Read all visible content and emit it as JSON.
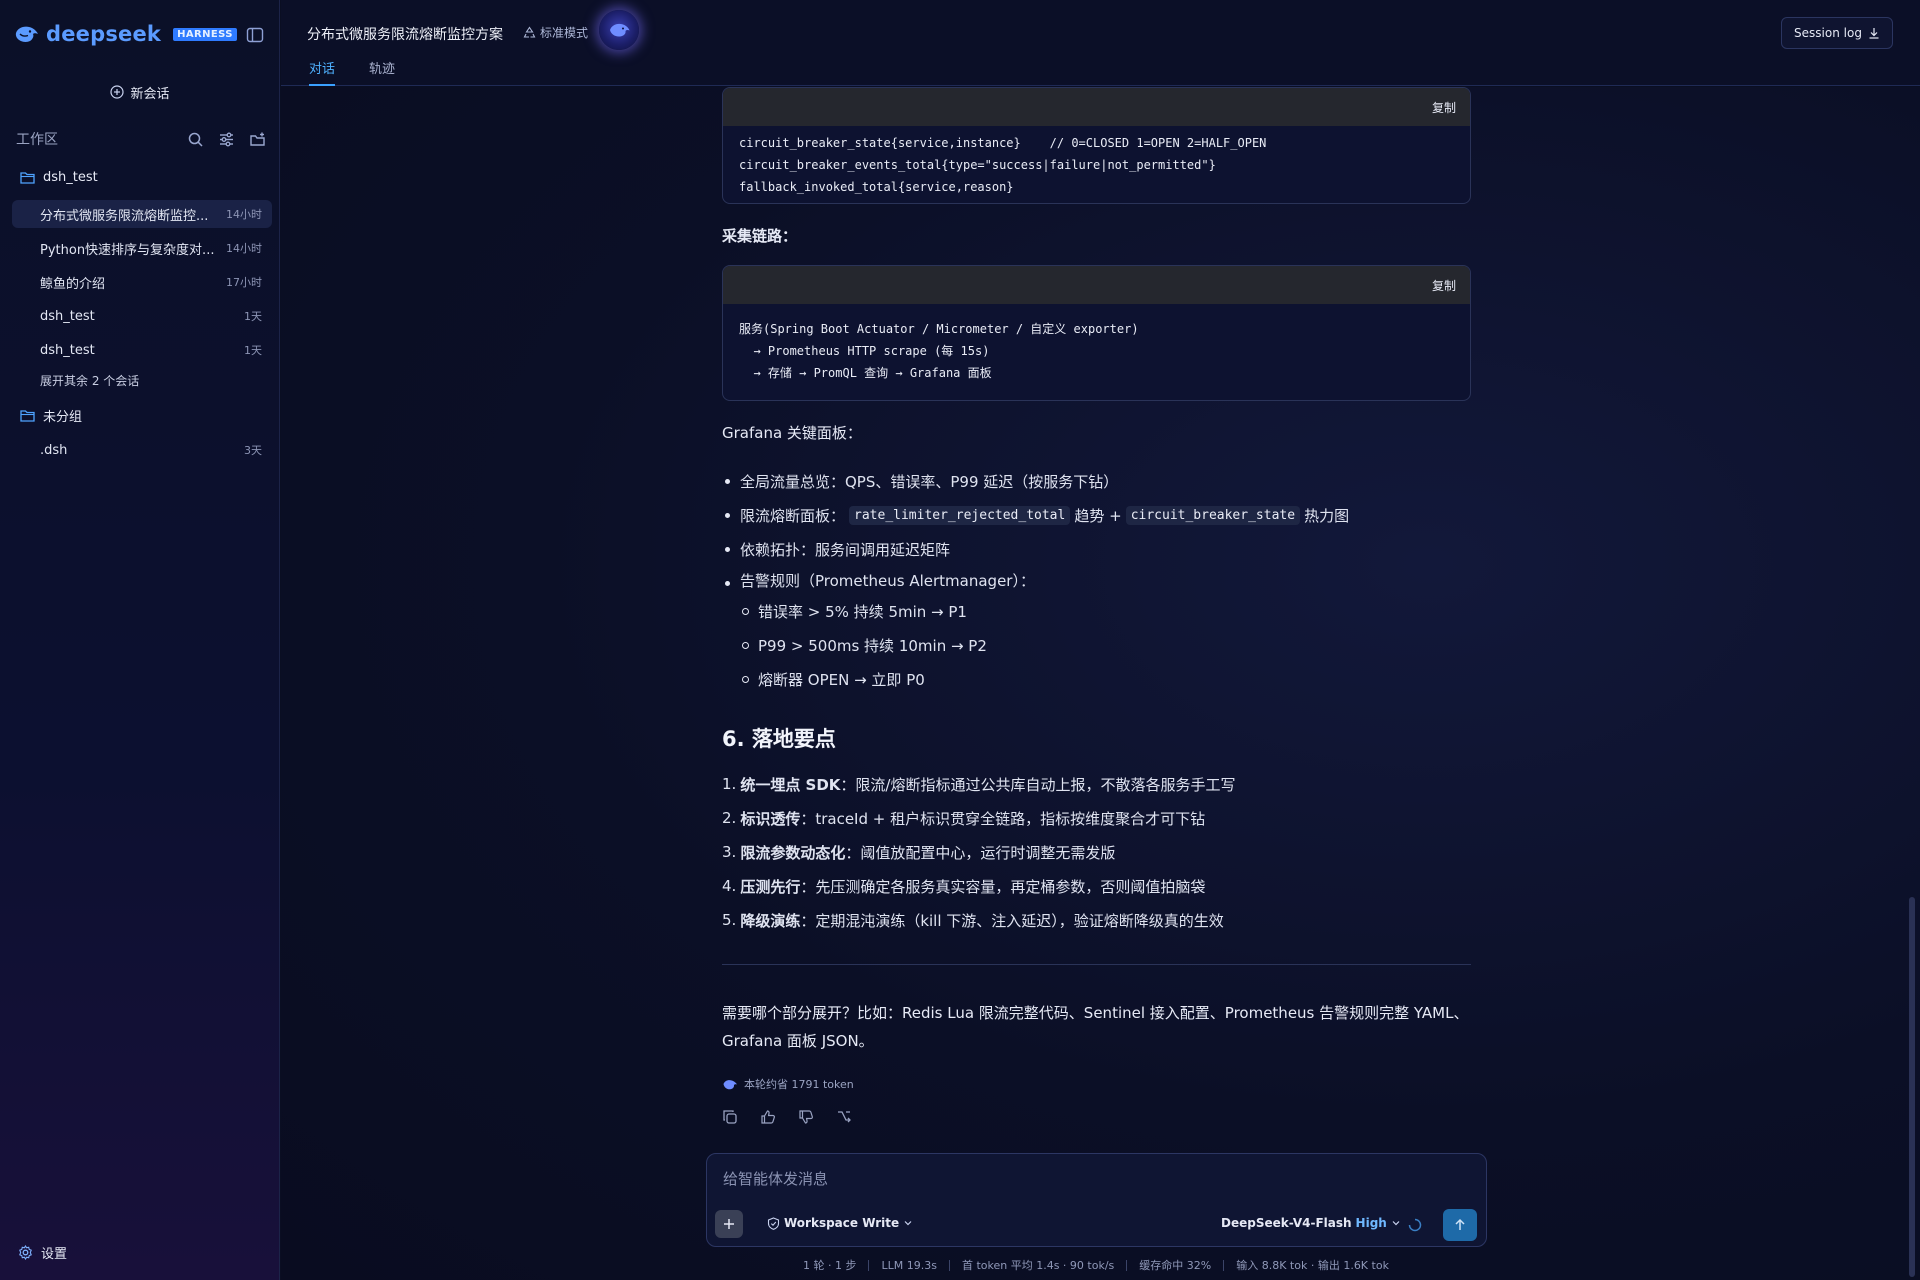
{
  "brand": {
    "name": "deepseek",
    "badge": "HARNESS",
    "color": "#5b9bff"
  },
  "sidebar": {
    "new_chat_label": "新会话",
    "workspace_label": "工作区",
    "folders": [
      {
        "name": "dsh_test",
        "conversations": [
          {
            "title": "分布式微服务限流熔断监控...",
            "time": "14小时",
            "active": true
          },
          {
            "title": "Python快速排序与复杂度对...",
            "time": "14小时",
            "active": false
          },
          {
            "title": "鲸鱼的介绍",
            "time": "17小时",
            "active": false
          },
          {
            "title": "dsh_test",
            "time": "1天",
            "active": false
          },
          {
            "title": "dsh_test",
            "time": "1天",
            "active": false
          }
        ],
        "expand_more": "展开其余 2 个会话"
      },
      {
        "name": "未分组",
        "conversations": [
          {
            "title": ".dsh",
            "time": "3天",
            "active": false
          }
        ]
      }
    ],
    "settings_label": "设置"
  },
  "header": {
    "title": "分布式微服务限流熔断监控方案",
    "mode": "标准模式",
    "tabs": [
      {
        "label": "对话",
        "active": true
      },
      {
        "label": "轨迹",
        "active": false
      }
    ],
    "session_log_label": "Session log"
  },
  "message": {
    "code_blocks": [
      {
        "copy_label": "复制",
        "lines": [
          "circuit_breaker_state{service,instance}    // 0=CLOSED 1=OPEN 2=HALF_OPEN",
          "circuit_breaker_events_total{type=\"success|failure|not_permitted\"}",
          "fallback_invoked_total{service,reason}"
        ]
      },
      {
        "copy_label": "复制",
        "lines": [
          "服务(Spring Boot Actuator / Micrometer / 自定义 exporter)",
          "  → Prometheus HTTP scrape (每 15s)",
          "  → 存储 → PromQL 查询 → Grafana 面板"
        ]
      }
    ],
    "collect_heading": "采集链路：",
    "grafana_heading": "Grafana 关键面板：",
    "bullets": {
      "b1": "全局流量总览：QPS、错误率、P99 延迟（按服务下钻）",
      "b2_prefix": "限流熔断面板：",
      "b2_code1": "rate_limiter_rejected_total",
      "b2_mid": "趋势 +",
      "b2_code2": "circuit_breaker_state",
      "b2_suffix": "热力图",
      "b3": "依赖拓扑：服务间调用延迟矩阵",
      "b4": "告警规则（Prometheus Alertmanager）：",
      "sub1": "错误率 > 5% 持续 5min → P1",
      "sub2": "P99 > 500ms 持续 10min → P2",
      "sub3": "熔断器 OPEN → 立即 P0"
    },
    "section_heading": "6. 落地要点",
    "steps": [
      {
        "num": "1.",
        "bold": "统一埋点 SDK",
        "rest": "：限流/熔断指标通过公共库自动上报，不散落各服务手工写"
      },
      {
        "num": "2.",
        "bold": "标识透传",
        "rest": "：traceId + 租户标识贯穿全链路，指标按维度聚合才可下钻"
      },
      {
        "num": "3.",
        "bold": "限流参数动态化",
        "rest": "：阈值放配置中心，运行时调整无需发版"
      },
      {
        "num": "4.",
        "bold": "压测先行",
        "rest": "：先压测确定各服务真实容量，再定桶参数，否则阈值拍脑袋"
      },
      {
        "num": "5.",
        "bold": "降级演练",
        "rest": "：定期混沌演练（kill 下游、注入延迟），验证熔断降级真的生效"
      }
    ],
    "closing": "需要哪个部分展开？比如：Redis Lua 限流完整代码、Sentinel 接入配置、Prometheus 告警规则完整 YAML、Grafana 面板 JSON。",
    "token_info": "本轮约省 1791 token"
  },
  "composer": {
    "placeholder": "给智能体发消息",
    "permission": "Workspace Write",
    "model": "DeepSeek-V4-Flash",
    "effort": "High",
    "send_color": "#1e6aa8"
  },
  "status_bar": {
    "turns": "1 轮 · 1 步",
    "llm": "LLM 19.3s",
    "first_token": "首 token 平均 1.4s · 90 tok/s",
    "cache": "缓存命中 32%",
    "io": "输入 8.8K tok · 输出 1.6K tok"
  }
}
